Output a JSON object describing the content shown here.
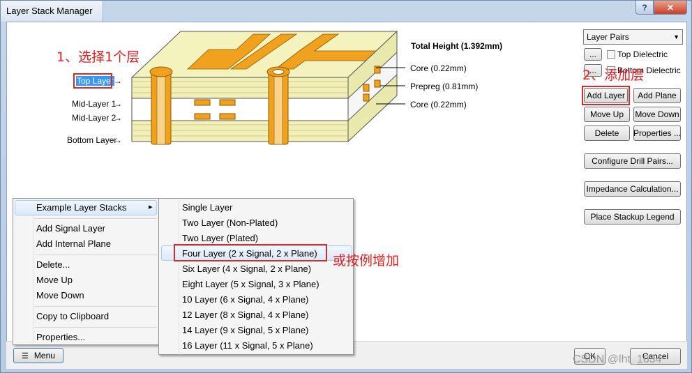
{
  "window": {
    "title": "Layer Stack Manager",
    "help_glyph": "?",
    "close_glyph": "✕"
  },
  "diagram": {
    "total_height": "Total Height (1.392mm)",
    "layer_labels": [
      "Top Layer",
      "Mid-Layer 1",
      "Mid-Layer 2",
      "Bottom Layer"
    ],
    "right_labels": [
      "Core (0.22mm)",
      "Prepreg (0.81mm)",
      "Core (0.22mm)"
    ],
    "arrow": "→"
  },
  "right_panel": {
    "layer_pairs_select": "Layer Pairs",
    "dots_label": "...",
    "top_dielectric": "Top Dielectric",
    "bottom_dielectric": "Bottom Dielectric",
    "add_layer": "Add Layer",
    "add_plane": "Add Plane",
    "move_up": "Move Up",
    "move_down": "Move Down",
    "delete": "Delete",
    "properties": "Properties ...",
    "configure_drill_pairs": "Configure Drill Pairs...",
    "impedance_calculation": "Impedance Calculation...",
    "place_stackup_legend": "Place Stackup Legend"
  },
  "context_menu": {
    "items": [
      "Example Layer Stacks",
      "Add Signal Layer",
      "Add Internal Plane",
      "Delete...",
      "Move Up",
      "Move Down",
      "Copy to Clipboard",
      "Properties..."
    ],
    "submenu_arrow": "▸"
  },
  "submenu": {
    "items": [
      "Single Layer",
      "Two Layer (Non-Plated)",
      "Two Layer (Plated)",
      "Four Layer (2 x Signal, 2 x Plane)",
      "Six Layer (4 x Signal, 2 x Plane)",
      "Eight Layer (5 x Signal, 3 x Plane)",
      "10 Layer (6 x Signal, 4 x Plane)",
      "12 Layer (8 x Signal, 4 x Plane)",
      "14 Layer (9 x Signal, 5 x Plane)",
      "16 Layer (11 x Signal, 5 x Plane)"
    ],
    "highlighted": "Four Layer (2 x Signal, 2 x Plane)"
  },
  "bottom": {
    "menu_button": "Menu",
    "ok": "OK",
    "cancel": "Cancel"
  },
  "annotations": {
    "step1": "1、选择1个层",
    "step2": "2、添加层",
    "or_example": "或按例增加"
  },
  "watermark": "CSDN @lht_1634",
  "colors": {
    "board": "#f0efb8",
    "copper": "#f0a21e",
    "annotation_red": "#d62b2b",
    "selection_blue": "#3399ff"
  }
}
